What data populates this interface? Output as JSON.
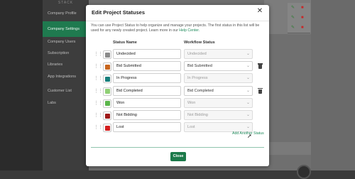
{
  "background": {
    "brand": "STACK",
    "nav_items": [
      {
        "label": "Company Profile",
        "active": false
      },
      {
        "label": "Company Settings",
        "active": true
      },
      {
        "label": "Company Users",
        "active": false
      },
      {
        "label": "Subscription",
        "active": false
      },
      {
        "label": "Libraries",
        "active": false
      },
      {
        "label": "App Integrations",
        "active": false
      },
      {
        "label": "Customer List",
        "active": false
      },
      {
        "label": "Labs",
        "active": false
      }
    ]
  },
  "modal": {
    "title": "Edit Project Statuses",
    "description": "You can use Project Status to help organize and manage your projects. The first status in this list will be used for any newly created project. Learn more in our",
    "help_link": "Help Center.",
    "columns": {
      "status_name": "Status Name",
      "workflow_status": "Workflow Status"
    },
    "statuses": [
      {
        "name": "Undecided",
        "workflow": "Undecided",
        "color": "#8a8a8a",
        "workflow_enabled": false,
        "deletable": false
      },
      {
        "name": "Bid Submitted",
        "workflow": "Bid Submitted",
        "color": "#c8661e",
        "workflow_enabled": true,
        "deletable": true
      },
      {
        "name": "In Progress",
        "workflow": "In Progress",
        "color": "#177f7c",
        "workflow_enabled": false,
        "deletable": false
      },
      {
        "name": "Bid Completed",
        "workflow": "Bid Completed",
        "color": "#8fcf74",
        "workflow_enabled": true,
        "deletable": true
      },
      {
        "name": "Won",
        "workflow": "Won",
        "color": "#5ab54a",
        "workflow_enabled": false,
        "deletable": false
      },
      {
        "name": "Not Bidding",
        "workflow": "Not Bidding",
        "color": "#9e1a1a",
        "workflow_enabled": false,
        "deletable": false
      },
      {
        "name": "Lost",
        "workflow": "Lost",
        "color": "#d41f1f",
        "workflow_enabled": false,
        "deletable": false
      }
    ],
    "add_another_label": "Add Another Status",
    "close_label": "Close"
  },
  "colors": {
    "accent": "#1f7a4f",
    "link": "#1f8a5b"
  }
}
